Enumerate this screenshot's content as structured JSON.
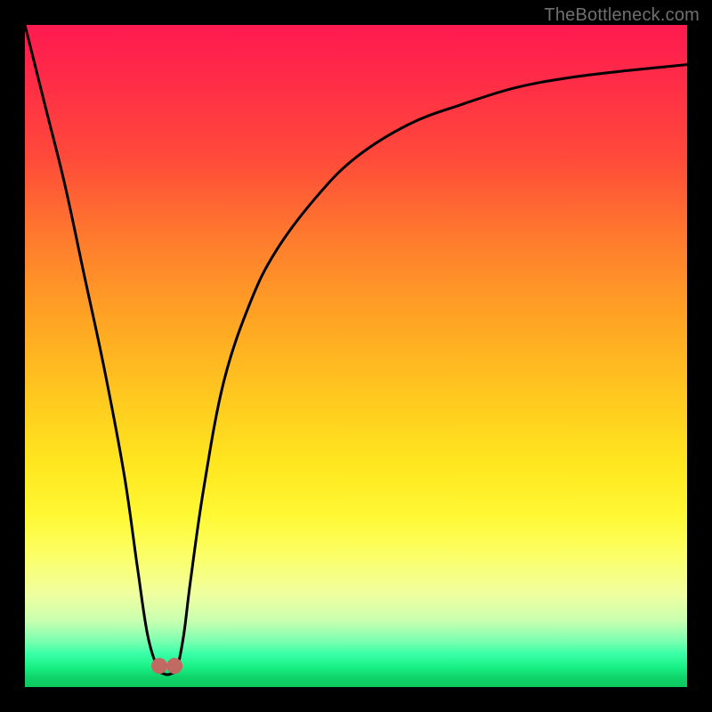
{
  "watermark": "TheBottleneck.com",
  "chart_data": {
    "type": "line",
    "title": "",
    "xlabel": "",
    "ylabel": "",
    "xlim": [
      0,
      100
    ],
    "ylim": [
      0,
      100
    ],
    "grid": false,
    "legend": null,
    "series": [
      {
        "name": "bottleneck-curve",
        "x": [
          0,
          3,
          6,
          9,
          12,
          15,
          17,
          18.5,
          20,
          21,
          22,
          23,
          24,
          25,
          27,
          30,
          34,
          38,
          44,
          50,
          58,
          66,
          74,
          82,
          90,
          100
        ],
        "y": [
          100,
          88,
          76,
          62,
          48,
          32,
          18,
          8,
          3,
          2,
          2,
          3,
          8,
          16,
          30,
          46,
          58,
          66,
          74,
          80,
          85,
          88,
          90.5,
          92,
          93,
          94
        ]
      }
    ],
    "markers": [
      {
        "x": 20.3,
        "y": 3.2
      },
      {
        "x": 22.6,
        "y": 3.2
      }
    ],
    "marker_color": "#c16a63",
    "curve_color": "#000000"
  }
}
